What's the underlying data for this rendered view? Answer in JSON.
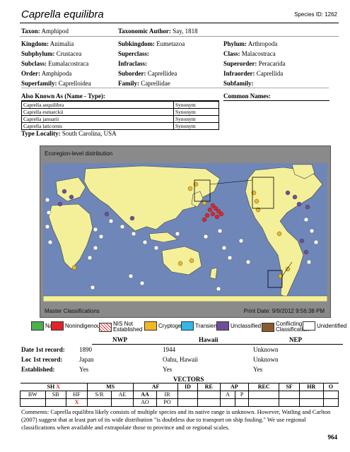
{
  "header": {
    "title": "Caprella equilibra",
    "species_id": "Species ID: 1262"
  },
  "taxonomy": {
    "taxon_label": "Taxon:",
    "taxon": "Amphipod",
    "author_label": "Taxonomic Author:",
    "author": "Say, 1818",
    "kingdom_label": "Kingdom:",
    "kingdom": "Animalia",
    "subkingdom_label": "Subkingdom:",
    "subkingdom": "Eumetazoa",
    "phylum_label": "Phylum:",
    "phylum": "Arthropoda",
    "subphylum_label": "Subphylum:",
    "subphylum": "Crustacea",
    "superclass_label": "Superclass:",
    "superclass": "",
    "class_label": "Class:",
    "class": "Malacostraca",
    "subclass_label": "Subclass:",
    "subclass": "Eumalacostraca",
    "infraclass_label": "Infraclass:",
    "infraclass": "",
    "superorder_label": "Superorder:",
    "superorder": "Peracarida",
    "order_label": "Order:",
    "order": "Amphipoda",
    "suborder_label": "Suborder:",
    "suborder": "Caprellidea",
    "infraorder_label": "Infraorder:",
    "infraorder": "Caprellida",
    "superfamily_label": "Superfamily:",
    "superfamily": "Caprelloidea",
    "family_label": "Family:",
    "family": "Caprellidae",
    "subfamily_label": "Subfamily:",
    "subfamily": ""
  },
  "synonyms": {
    "heading": "Also Known As (Name - Type):",
    "common_heading": "Common Names:",
    "rows": [
      {
        "name": "Caprella aequilibra",
        "type": "Synonym"
      },
      {
        "name": "Caprella esmarckii",
        "type": "Synonym"
      },
      {
        "name": "Caprella januarii",
        "type": "Synonym"
      },
      {
        "name": "Caprella laticornis",
        "type": "Synonym"
      }
    ]
  },
  "locality": {
    "label": "Type Locality:",
    "value": "South Carolina, USA"
  },
  "map": {
    "top_label": "Ecoregion-level distribution",
    "bottom_left": "Master Classifications",
    "print_date": "Print Date: 9/9/2012 9:56:38 PM",
    "ocean_color": "#6f86b8",
    "land_color": "#f4f09a"
  },
  "legend": [
    {
      "label": "Native",
      "color": "#4caf50"
    },
    {
      "label": "Nonindigenous",
      "color": "#e0242a"
    },
    {
      "label": "NIS Not Established",
      "color": "#ffffff"
    },
    {
      "label": "Cryptogenic",
      "color": "#f2b824"
    },
    {
      "label": "Transient",
      "color": "#31b8e8"
    },
    {
      "label": "Unclassified",
      "color": "#6e4f96"
    },
    {
      "label": "Conflicting Classification",
      "color": "#8b5a2b"
    },
    {
      "label": "Unidentified",
      "color": "#ffffff"
    }
  ],
  "records": {
    "regions": [
      "NWP",
      "Hawaii",
      "NEP"
    ],
    "date_label": "Date 1st record:",
    "dates": [
      "1890",
      "1944",
      "Unknown"
    ],
    "loc_label": "Loc 1st record:",
    "locs": [
      "Japan",
      "Oahu, Hawaii",
      "Unknown"
    ],
    "est_label": "Established:",
    "est": [
      "Yes",
      "Yes",
      "Yes"
    ]
  },
  "vectors": {
    "heading": "VECTORS",
    "row1": [
      "SH",
      "X",
      "MS",
      "AF",
      "ID",
      "RE",
      "AP",
      "REC",
      "SF",
      "HR",
      "O"
    ],
    "row2": [
      "BW",
      "SB",
      "HF",
      "S/R",
      "AE",
      "AA",
      "IR",
      "A",
      "P"
    ],
    "row3": [
      "X",
      "AO",
      "PO"
    ]
  },
  "comments": "Comments: Caprella equilibra likely consists of multiple species and its native range is unknown. However, Watling and Carlton (2007) suggest that at least part of its wide distribution \"is doubtless due to transport on ship fouling.\" We use regional classifications when available and extrapolate those to province and or regional scales.",
  "page_number": "964"
}
